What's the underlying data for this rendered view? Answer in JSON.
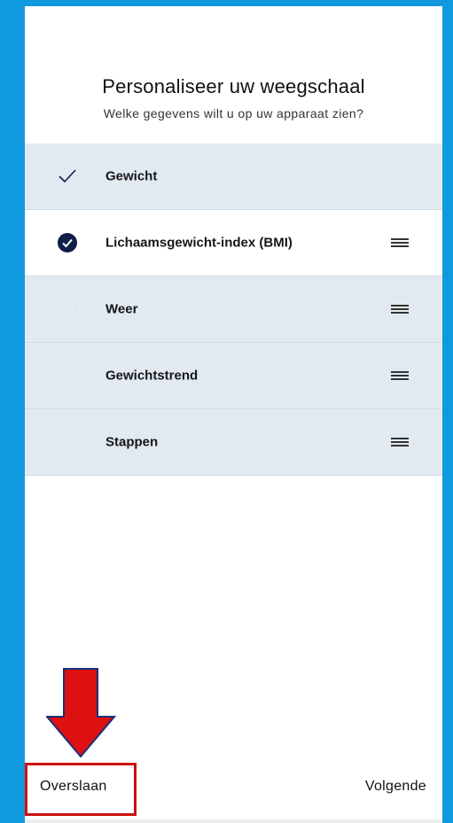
{
  "header": {
    "title": "Personaliseer uw weegschaal",
    "subtitle": "Welke gegevens wilt u op uw apparaat zien?"
  },
  "options": [
    {
      "label": "Gewicht",
      "state": "check-locked"
    },
    {
      "label": "Lichaamsgewicht-index (BMI)",
      "state": "checked"
    },
    {
      "label": "Weer",
      "state": "unchecked"
    },
    {
      "label": "Gewichtstrend",
      "state": "unchecked"
    },
    {
      "label": "Stappen",
      "state": "unchecked"
    }
  ],
  "footer": {
    "skip_label": "Overslaan",
    "next_label": "Volgende"
  },
  "colors": {
    "background": "#1199dd",
    "accent": "#0f1f4a",
    "annotation": "#dd1111"
  }
}
